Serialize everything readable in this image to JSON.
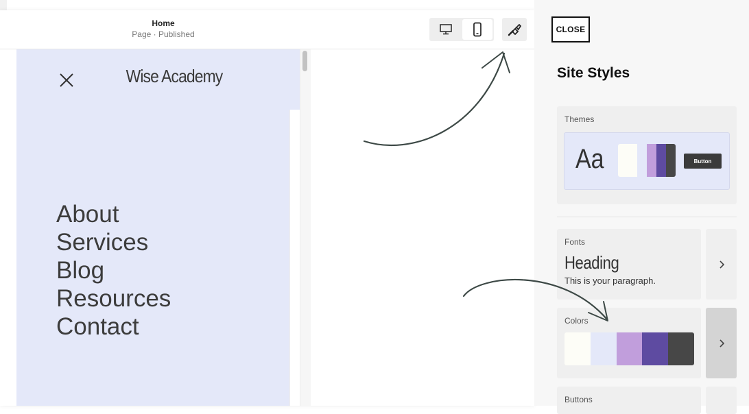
{
  "header": {
    "page_title": "Home",
    "page_status": "Page · Published"
  },
  "site": {
    "name": "Wise Academy",
    "nav": [
      "About",
      "Services",
      "Blog",
      "Resources",
      "Contact"
    ]
  },
  "panel": {
    "close_label": "CLOSE",
    "title": "Site Styles",
    "themes": {
      "label": "Themes",
      "sample_text": "Aa",
      "button_label": "Button",
      "swatches": [
        "#fdfdf7",
        "#e4e8f9",
        "#c19edc",
        "#5e4ba1",
        "#474747"
      ]
    },
    "fonts": {
      "label": "Fonts",
      "heading_sample": "Heading",
      "paragraph_sample": "This is your paragraph."
    },
    "colors": {
      "label": "Colors",
      "palette": [
        "#fdfdf7",
        "#e4e8f9",
        "#c19edc",
        "#5e4ba1",
        "#474747"
      ]
    },
    "buttons": {
      "label": "Buttons"
    }
  },
  "icons": {
    "desktop": "desktop-icon",
    "mobile": "mobile-icon",
    "style": "paintbrush-icon",
    "menu_close": "close-icon",
    "chevron": "chevron-right-icon"
  }
}
